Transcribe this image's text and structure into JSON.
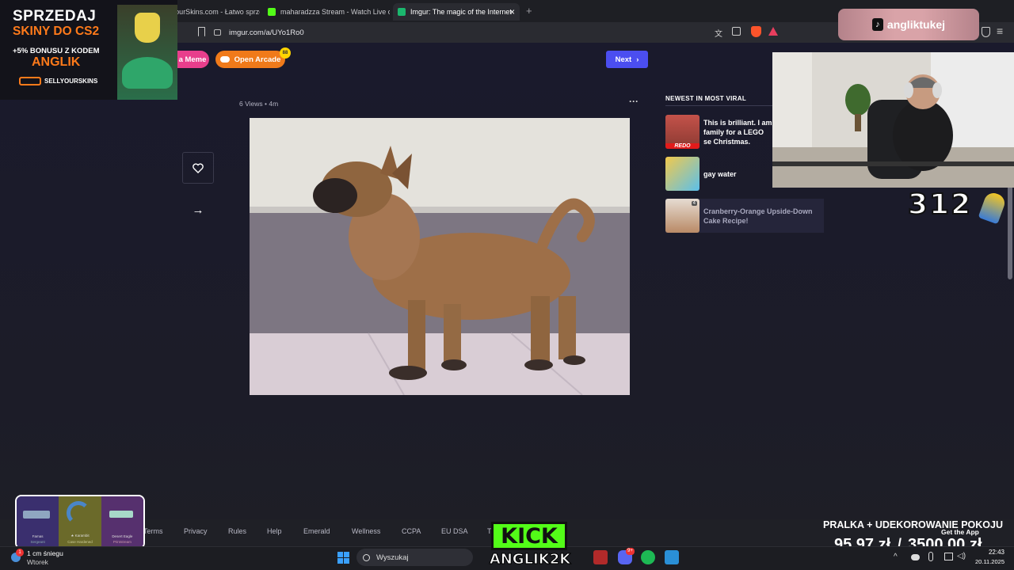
{
  "browser": {
    "tabs": [
      {
        "label": "YourSkins.com - Łatwo sprzed",
        "active": false
      },
      {
        "label": "maharadzza Stream - Watch Live on K",
        "active": false
      },
      {
        "label": "Imgur: The magic of the Internet",
        "active": true
      }
    ],
    "new_tab": "+",
    "close_tab": "×",
    "url": "imgur.com/a/UYo1Ro0"
  },
  "imgur": {
    "make_meme": "a Meme",
    "open_arcade": "Open Arcade",
    "arcade_badge": "88",
    "next": "Next",
    "views": "6 Views",
    "sep": "•",
    "age": "4m",
    "more": "···",
    "newest_title": "NEWEST IN MOST VIRAL",
    "newest_items": [
      {
        "text": "This is brilliant. I am family for a LEGO se Christmas.",
        "tag": "REDO"
      },
      {
        "text": "gay water",
        "tag": ""
      },
      {
        "text": "Cranberry-Orange Upside-Down Cake Recipe!",
        "tag": "4"
      }
    ],
    "footer_links": [
      "Terms",
      "Privacy",
      "Rules",
      "Help",
      "Emerald",
      "Wellness",
      "CCPA",
      "EU DSA",
      "T"
    ],
    "get_app": "Get the App"
  },
  "stream": {
    "ad_line1": "SPRZEDAJ",
    "ad_line2": "SKINY DO CS2",
    "ad_line3": "+5% BONUSU Z KODEM",
    "ad_line4": "ANGLIK",
    "ad_brand": "SELLYOURSKINS",
    "tiktok_handle": "angliktukej",
    "counter": "312",
    "goal_label": "PRALKA + UDEKOROWANIE POKOJU",
    "goal_current": "95,97 zł",
    "goal_slash": "/",
    "goal_target": "3500,00 zł",
    "kick_logo": "KICK",
    "kick_handle": "ANGLIK2K",
    "skins": [
      {
        "name": "Famas",
        "sub": "Sergeant"
      },
      {
        "name": "★ Karambit",
        "sub": "Case Hardened"
      },
      {
        "name": "Desert Eagle",
        "sub": "Printstream"
      }
    ]
  },
  "taskbar": {
    "weather_temp": "1 cm śniegu",
    "weather_day": "Wtorek",
    "search_placeholder": "Wyszukaj",
    "time": "22:43",
    "date": "20.11.2025",
    "notif_count": "1",
    "discord_badge": "9+"
  },
  "colors": {
    "imgur_next": "#4b4ef0",
    "meme_pink": "#e83e8c",
    "arcade_orange": "#f07a1a",
    "kick_green": "#53fc18",
    "page_bg": "#1b1b2a"
  }
}
